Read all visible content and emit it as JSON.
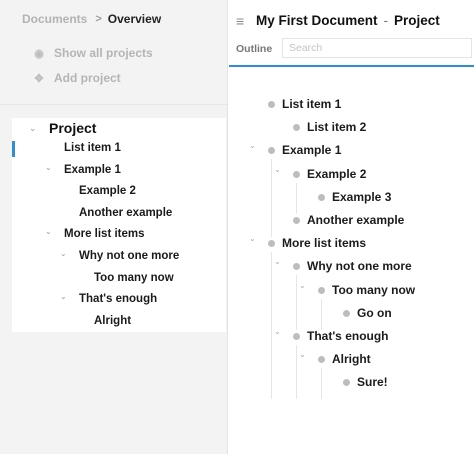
{
  "breadcrumb": {
    "root": "Documents",
    "separator": ">",
    "current": "Overview"
  },
  "sidebar": {
    "actions": [
      {
        "label": "Show all projects",
        "icon": "eye-icon"
      },
      {
        "label": "Add project",
        "icon": "move-icon"
      }
    ],
    "project": {
      "title": "Project",
      "nodes": [
        {
          "label": "List item 1",
          "depth": 0,
          "has_children": false,
          "selected": true
        },
        {
          "label": "Example 1",
          "depth": 0,
          "has_children": true
        },
        {
          "label": "Example 2",
          "depth": 1,
          "has_children": false
        },
        {
          "label": "Another example",
          "depth": 1,
          "has_children": false
        },
        {
          "label": "More list items",
          "depth": 0,
          "has_children": true
        },
        {
          "label": "Why not one more",
          "depth": 1,
          "has_children": true
        },
        {
          "label": "Too many now",
          "depth": 2,
          "has_children": false
        },
        {
          "label": "That's enough",
          "depth": 1,
          "has_children": true
        },
        {
          "label": "Alright",
          "depth": 2,
          "has_children": false
        }
      ]
    }
  },
  "header": {
    "menu_icon": "hamburger-icon",
    "title": "My First Document",
    "separator": "-",
    "project": "Project"
  },
  "toolbar": {
    "tab": "Outline",
    "search_placeholder": "Search"
  },
  "outline": [
    {
      "label": "List item 1",
      "depth": 0,
      "has_children": false
    },
    {
      "label": "List item 2",
      "depth": 1,
      "has_children": false
    },
    {
      "label": "Example 1",
      "depth": 0,
      "has_children": true
    },
    {
      "label": "Example 2",
      "depth": 1,
      "has_children": true
    },
    {
      "label": "Example 3",
      "depth": 2,
      "has_children": false
    },
    {
      "label": "Another example",
      "depth": 1,
      "has_children": false
    },
    {
      "label": "More list items",
      "depth": 0,
      "has_children": true
    },
    {
      "label": "Why not one more",
      "depth": 1,
      "has_children": true
    },
    {
      "label": "Too many now",
      "depth": 2,
      "has_children": true
    },
    {
      "label": "Go on",
      "depth": 3,
      "has_children": false
    },
    {
      "label": "That's enough",
      "depth": 1,
      "has_children": true
    },
    {
      "label": "Alright",
      "depth": 2,
      "has_children": true
    },
    {
      "label": "Sure!",
      "depth": 3,
      "has_children": false
    }
  ],
  "colors": {
    "accent": "#2f8fd2",
    "sidebar_bg": "#f3f3f4",
    "bullet": "#bdbdbd"
  }
}
